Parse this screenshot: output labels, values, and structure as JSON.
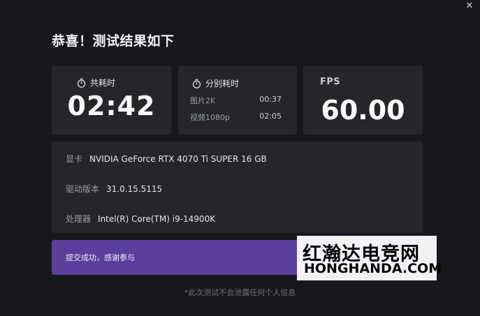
{
  "window": {
    "close_symbol": "✕",
    "title": "恭喜！测试结果如下"
  },
  "total_card": {
    "icon": "timer-icon",
    "label": "共耗时",
    "value": "02:42"
  },
  "split_card": {
    "icon": "timer-icon",
    "label": "分别耗时",
    "rows": [
      {
        "name": "图片2K",
        "time": "00:37"
      },
      {
        "name": "视频1080p",
        "time": "02:05"
      }
    ]
  },
  "fps_card": {
    "label": "FPS",
    "value": "60.00"
  },
  "info": {
    "gpu_label": "显卡",
    "gpu_value": "NVIDIA GeForce RTX 4070 Ti SUPER 16 GB",
    "driver_label": "驱动版本",
    "driver_value": "31.0.15.5115",
    "cpu_label": "处理器",
    "cpu_value": "Intel(R) Core(TM) i9-14900K"
  },
  "submit": {
    "message": "提交成功，感谢参与"
  },
  "watermark": {
    "cn": "红瀚达电竞网",
    "en": "HONGHANDA.COM"
  },
  "footer": {
    "note": "*此次测试不会泄露任何个人信息"
  },
  "colors": {
    "background": "#17181c",
    "card": "#24262b",
    "accent": "#5b3f9c"
  }
}
